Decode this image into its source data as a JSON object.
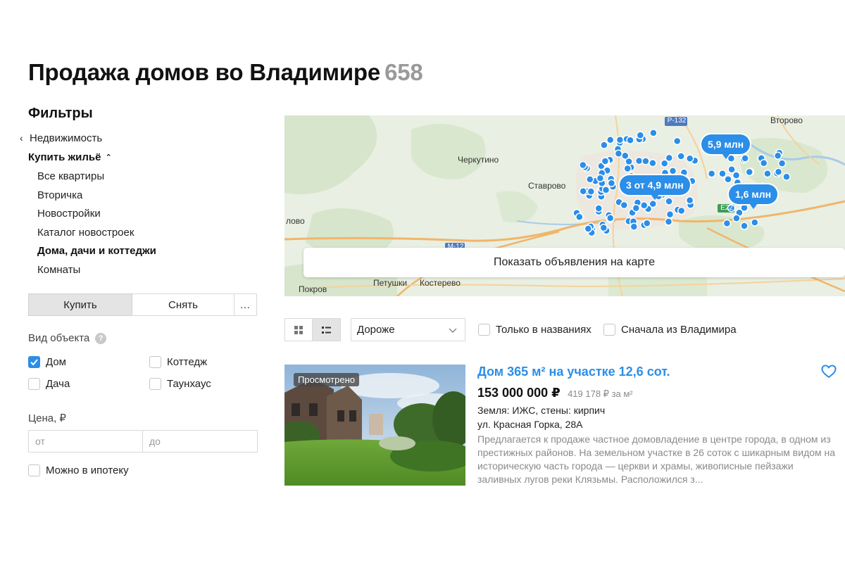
{
  "header": {
    "title": "Продажа домов во Владимире",
    "count": "658"
  },
  "sidebar": {
    "heading": "Фильтры",
    "back_label": "Недвижимость",
    "category_label": "Купить жильё",
    "categories": [
      {
        "label": "Все квартиры"
      },
      {
        "label": "Вторичка"
      },
      {
        "label": "Новостройки"
      },
      {
        "label": "Каталог новостроек"
      },
      {
        "label": "Дома, дачи и коттеджи"
      },
      {
        "label": "Комнаты"
      }
    ],
    "deal": {
      "buy_label": "Купить",
      "rent_label": "Снять",
      "more_label": "..."
    },
    "object_type": {
      "label": "Вид объекта",
      "help": "?",
      "options": [
        {
          "label": "Дом",
          "checked": true
        },
        {
          "label": "Коттедж",
          "checked": false
        },
        {
          "label": "Дача",
          "checked": false
        },
        {
          "label": "Таунхаус",
          "checked": false
        }
      ]
    },
    "price": {
      "label": "Цена, ₽",
      "from_placeholder": "от",
      "to_placeholder": "до"
    },
    "mortgage_label": "Можно в ипотеку"
  },
  "map": {
    "show_button": "Показать объявления на карте",
    "labels": {
      "r132": "Р-132",
      "vtorovo": "Второво",
      "cherkutino": "Черкутино",
      "stavrovo": "Ставрово",
      "lovo": "лово",
      "e22": "E22",
      "m12": "М-12",
      "pokrov": "Покров",
      "petushki": "Петушки",
      "kosterevo": "Костерево"
    },
    "pins": [
      {
        "label": "5,9 млн"
      },
      {
        "label": "3 от 4,9 млн"
      },
      {
        "label": "1,6 млн"
      }
    ]
  },
  "toolbar": {
    "sort_value": "Дороже",
    "only_titles_label": "Только в названиях",
    "vladimir_first_label": "Сначала из Владимира"
  },
  "listing": {
    "badge": "Просмотрено",
    "title": "Дом 365 м² на участке 12,6 сот.",
    "price": "153 000 000 ₽",
    "price_per_sqm": "419 178 ₽ за м²",
    "specs": "Земля: ИЖС, стены: кирпич",
    "address": "ул. Красная Горка, 28А",
    "description": "Предлагается к продаже частное домовладение в центре города, в одном из престижных районов. На земельном участке в 26 соток с шикарным видом на историческую часть города — церкви и храмы, живописные пейзажи заливных лугов реки Клязьмы. Расположился з..."
  },
  "colors": {
    "accent": "#2b8ee8",
    "muted": "#8a8a8a"
  }
}
